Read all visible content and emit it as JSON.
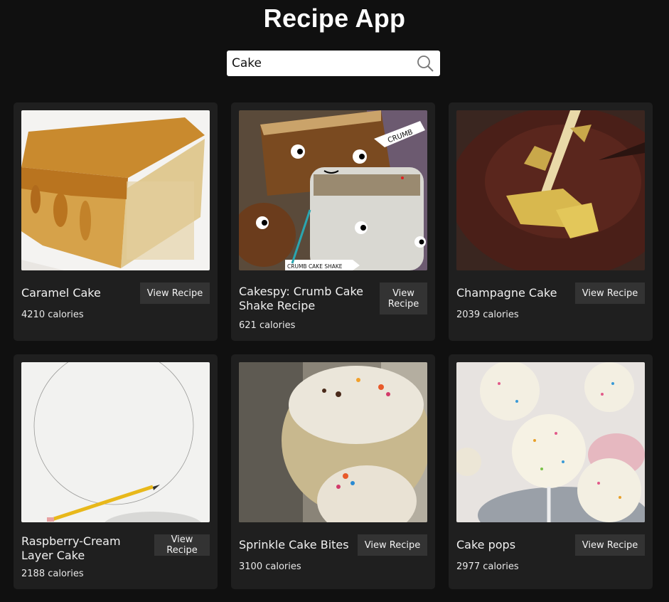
{
  "app": {
    "title": "Recipe App"
  },
  "search": {
    "value": "Cake",
    "icon": "search-icon"
  },
  "recipes": [
    {
      "name": "Caramel Cake",
      "calories": "4210 calories",
      "button": "View Recipe"
    },
    {
      "name": "Cakespy: Crumb Cake Shake Recipe",
      "calories": "621 calories",
      "button": "View Recipe"
    },
    {
      "name": "Champagne Cake",
      "calories": "2039 calories",
      "button": "View Recipe"
    },
    {
      "name": "Raspberry-Cream Layer Cake",
      "calories": "2188 calories",
      "button": "View Recipe"
    },
    {
      "name": "Sprinkle Cake Bites",
      "calories": "3100 calories",
      "button": "View Recipe"
    },
    {
      "name": "Cake pops",
      "calories": "2977 calories",
      "button": "View Recipe"
    }
  ],
  "photo_labels": {
    "crumb": "CRUMB",
    "crumb_cake_shake": "CRUMB CAKE SHAKE"
  },
  "colors": {
    "background": "#101010",
    "card": "#1f1f1f",
    "button": "#333333",
    "text": "#ffffff"
  }
}
